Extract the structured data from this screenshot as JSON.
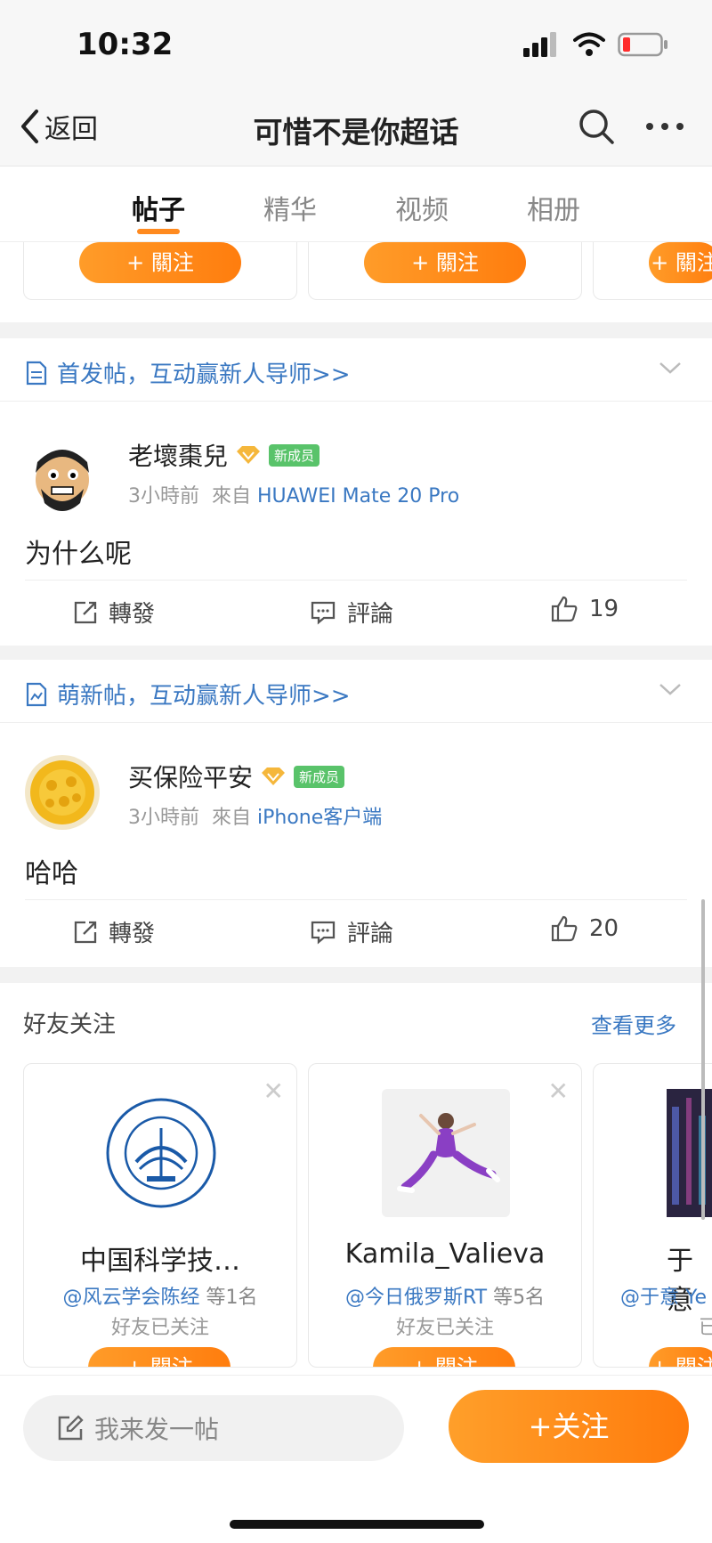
{
  "status": {
    "time": "10:32"
  },
  "nav": {
    "back_label": "返回",
    "title": "可惜不是你超话"
  },
  "tabs": [
    "帖子",
    "精华",
    "视频",
    "相册"
  ],
  "top_cards": {
    "follow_label": "+ 關注"
  },
  "posts": [
    {
      "section": "首发帖，互动赢新人导师>>",
      "username": "老壞棗兒",
      "badge": "新成员",
      "time": "3小時前",
      "from_prefix": "來自",
      "source": "HUAWEI Mate 20 Pro",
      "content": "为什么呢",
      "repost": "轉發",
      "comment": "評論",
      "likes": "19"
    },
    {
      "section": "萌新帖，互动赢新人导师>>",
      "username": "买保险平安",
      "badge": "新成员",
      "time": "3小時前",
      "from_prefix": "來自",
      "source": "iPhone客户端",
      "content": "哈哈",
      "repost": "轉發",
      "comment": "評論",
      "likes": "20"
    }
  ],
  "friends": {
    "title": "好友关注",
    "see_more": "查看更多",
    "cards": [
      {
        "name": "中国科学技…",
        "at": "@风云学会陈经",
        "count": "等1名",
        "note": "好友已关注",
        "follow_label": "+ 關注"
      },
      {
        "name": "Kamila_Valieva",
        "at": "@今日俄罗斯RT",
        "count": "等5名",
        "note": "好友已关注",
        "follow_label": "+ 關注"
      },
      {
        "name": "于意",
        "at": "@于意 Ye",
        "count": "",
        "note": "已",
        "follow_label": "+ 關注"
      }
    ]
  },
  "bottom": {
    "compose_placeholder": "我来发一帖",
    "follow_label": "+关注"
  },
  "colors": {
    "accent": "#ff8a1f",
    "link": "#3a78c2",
    "badge_green": "#59c36a"
  }
}
